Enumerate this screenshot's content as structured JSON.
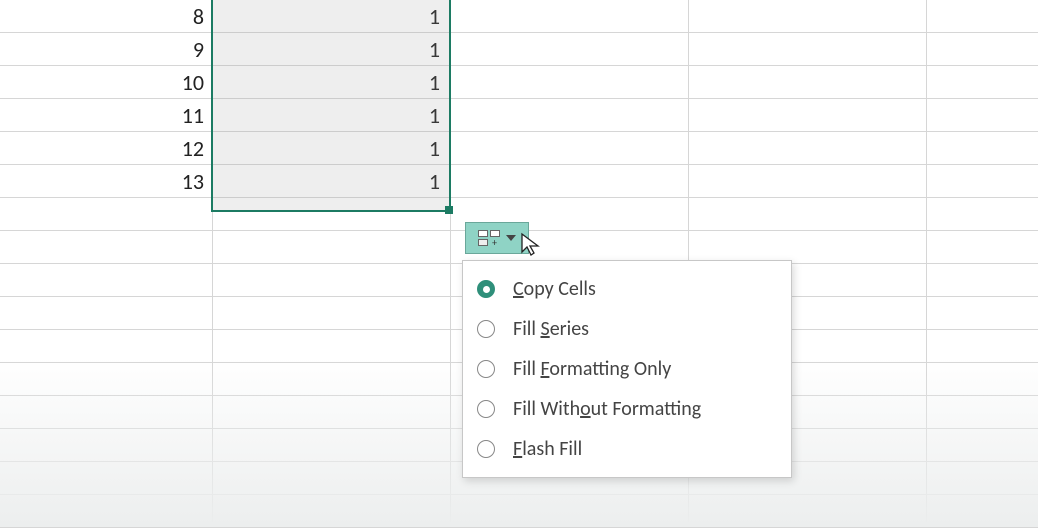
{
  "rows": [
    {
      "num": "8",
      "val": "1"
    },
    {
      "num": "9",
      "val": "1"
    },
    {
      "num": "10",
      "val": "1"
    },
    {
      "num": "11",
      "val": "1"
    },
    {
      "num": "12",
      "val": "1"
    },
    {
      "num": "13",
      "val": "1"
    }
  ],
  "menu": {
    "copyCells": {
      "pre": "",
      "accel": "C",
      "post": "opy Cells"
    },
    "fillSeries": {
      "pre": "Fill ",
      "accel": "S",
      "post": "eries"
    },
    "fillFormattingOnly": {
      "pre": "Fill ",
      "accel": "F",
      "post": "ormatting Only"
    },
    "fillWithoutFormatting": {
      "pre": "Fill With",
      "accel": "o",
      "post": "ut Formatting"
    },
    "flashFill": {
      "pre": "",
      "accel": "F",
      "post": "lash Fill"
    },
    "selected": "copyCells"
  }
}
